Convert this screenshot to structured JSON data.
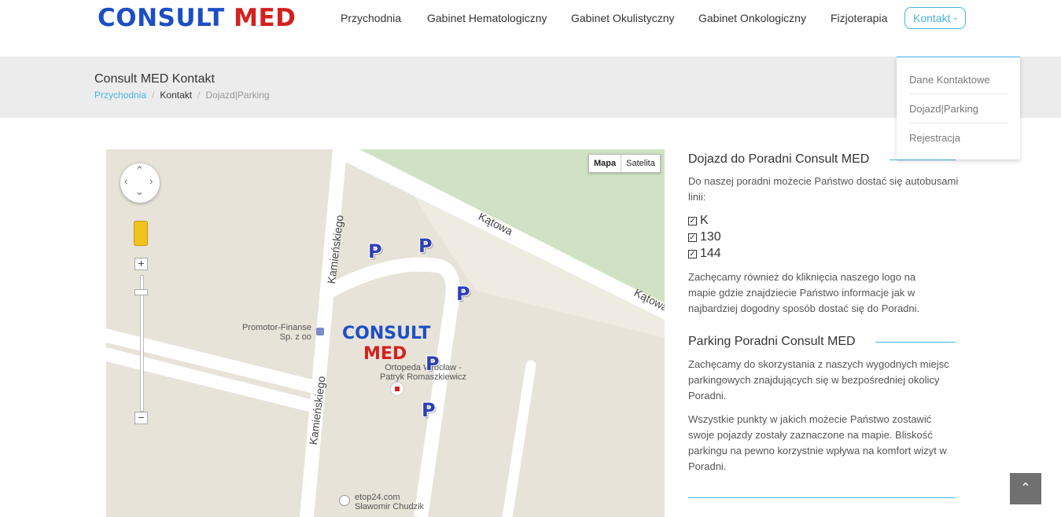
{
  "logo": {
    "part1": "CONSULT",
    "part2": "MED"
  },
  "nav": {
    "items": [
      "Przychodnia",
      "Gabinet Hematologiczny",
      "Gabinet Okulistyczny",
      "Gabinet Onkologiczny",
      "Fizjoterapia"
    ],
    "active": "Kontakt"
  },
  "dropdown": {
    "items": [
      "Dane Kontaktowe",
      "Dojazd|Parking",
      "Rejestracja"
    ]
  },
  "titlebar": {
    "title": "Consult MED Kontakt",
    "breadcrumb": [
      "Przychodnia",
      "Kontakt",
      "Dojazd|Parking"
    ]
  },
  "map": {
    "type_buttons": [
      "Mapa",
      "Satelita"
    ],
    "zoom_in": "+",
    "zoom_out": "−",
    "streets": {
      "kamienskiego": "Kamieńskiego",
      "katowa": "Kątowa"
    },
    "pois": {
      "promotor_line1": "Promotor-Finanse",
      "promotor_line2": "Sp. z oo",
      "ortopeda_line1": "Ortopeda Wrocław -",
      "ortopeda_line2": "Patryk Romaszkiewicz",
      "etop_line1": "etop24.com",
      "etop_line2": "Sławomir Chudzik"
    },
    "logo": {
      "part1": "CONSULT",
      "part2": "MED"
    },
    "parking_label": "P"
  },
  "content": {
    "section1_title": "Dojazd do Poradni Consult MED",
    "section1_intro": "Do naszej poradni możecie Państwo dostać się autobusami linii:",
    "bus_lines": [
      "K",
      "130",
      "144"
    ],
    "section1_text": "Zachęcamy również do kliknięcia naszego logo na mapie gdzie znajdziecie Państwo informacje jak w najbardziej dogodny sposób dostać się do Poradni.",
    "section2_title": "Parking Poradni Consult MED",
    "section2_p1": "Zachęcamy do skorzystania z naszych wygodnych miejsc parkingowych znajdujących się w bezpośredniej okolicy Poradni.",
    "section2_p2": "Wszystkie punkty w jakich możecie Państwo zostawić swoje pojazdy zostały zaznaczone na mapie. Bliskość parkingu na pewno korzystnie wpływa na komfort wizyt w Poradni."
  },
  "colors": {
    "accent": "#45b5e3",
    "logo_blue": "#1c4fc4",
    "logo_red": "#d4211f"
  }
}
